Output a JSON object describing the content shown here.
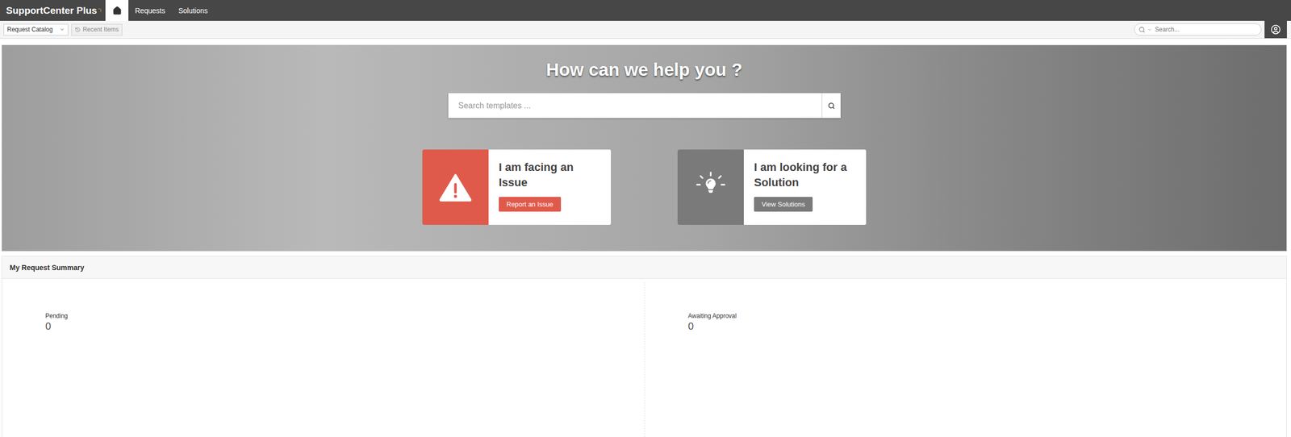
{
  "window": {
    "title": "SupportCenter Plus"
  },
  "nav": {
    "logo": "SupportCenter Plus",
    "home": {
      "selected": true
    },
    "tabs": [
      {
        "label": "Requests",
        "selected": false
      },
      {
        "label": "Solutions",
        "selected": false
      }
    ]
  },
  "toolbar": {
    "catalog": "Request Catalog",
    "recent": "Recent Items",
    "search": {
      "placeholder": "Search..."
    }
  },
  "hero": {
    "title": "How can we help you ?",
    "search": {
      "placeholder": "Search templates ..."
    },
    "cards": [
      {
        "kind": "issue",
        "title": "I am facing an Issue",
        "button": "Report an Issue",
        "color": "#e05a4b"
      },
      {
        "kind": "solution",
        "title": "I am looking for a Solution",
        "button": "View Solutions",
        "color": "#7a7a7a"
      }
    ]
  },
  "summary": {
    "title": "My Request Summary",
    "items": [
      {
        "label": "Pending",
        "count": "0"
      },
      {
        "label": "Awaiting Approval",
        "count": "0"
      }
    ]
  }
}
